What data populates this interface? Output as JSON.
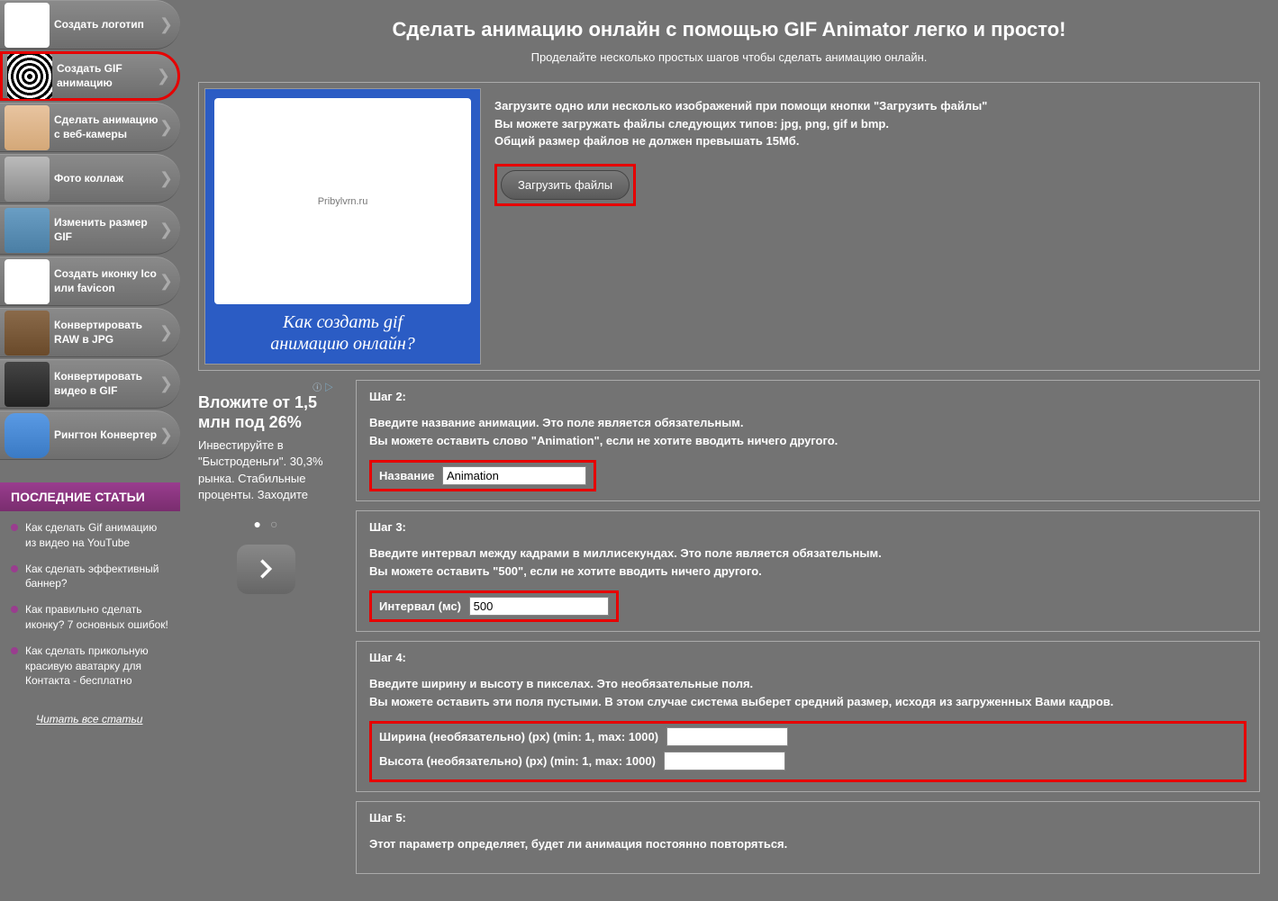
{
  "nav": [
    {
      "label": "Создать логотип",
      "icon": "logo"
    },
    {
      "label": "Создать GIF анимацию",
      "icon": "swirl",
      "active": true
    },
    {
      "label": "Сделать анимацию с веб-камеры",
      "icon": "face"
    },
    {
      "label": "Фото коллаж",
      "icon": "columns"
    },
    {
      "label": "Изменить размер GIF",
      "icon": "resize"
    },
    {
      "label": "Создать иконку Ico или favicon",
      "icon": "ico"
    },
    {
      "label": "Конвертировать RAW в JPG",
      "icon": "raw"
    },
    {
      "label": "Конвертировать видео в GIF",
      "icon": "video"
    },
    {
      "label": "Рингтон Конвертер",
      "icon": "ringtone"
    }
  ],
  "sidebar_section": "ПОСЛЕДНИЕ СТАТЬИ",
  "articles": [
    "Как сделать Gif анимацию из видео на YouTube",
    "Как сделать эффективный баннер?",
    "Как правильно сделать иконку? 7 основных ошибок!",
    "Как сделать прикольную красивую аватарку для Контакта - бесплатно"
  ],
  "read_all": "Читать все статьи",
  "title": "Сделать анимацию онлайн с помощью GIF Animator легко и просто!",
  "subtitle": "Проделайте несколько простых шагов чтобы сделать анимацию онлайн.",
  "ad1": {
    "line1": "Как создать gif",
    "line2": "анимацию онлайн?"
  },
  "upload": {
    "line1": "Загрузите одно или несколько изображений при помощи кнопки \"Загрузить файлы\"",
    "line2": "Вы можете загружать файлы следующих типов: jpg, png, gif и bmp.",
    "line3": "Общий размер файлов не должен превышать 15Мб.",
    "button": "Загрузить файлы"
  },
  "ad2": {
    "choices": "AdChoices",
    "title": "Вложите от 1,5 млн под 26%",
    "body": "Инвестируйте в \"Быстроденьги\". 30,3% рынка. Стабильные проценты. Заходите"
  },
  "step2": {
    "title": "Шаг 2:",
    "desc1": "Введите название анимации. Это поле является обязательным.",
    "desc2": "Вы можете оставить слово \"Animation\", если не хотите вводить ничего другого.",
    "label": "Название",
    "value": "Animation"
  },
  "step3": {
    "title": "Шаг 3:",
    "desc1": "Введите интервал между кадрами в миллисекундах. Это поле является обязательным.",
    "desc2": "Вы можете оставить \"500\", если не хотите вводить ничего другого.",
    "label": "Интервал (мс)",
    "value": "500"
  },
  "step4": {
    "title": "Шаг 4:",
    "desc1": "Введите ширину и высоту в пикселах. Это необязательные поля.",
    "desc2": "Вы можете оставить эти поля пустыми. В этом случае система выберет средний размер, исходя из загруженных Вами кадров.",
    "width_label": "Ширина (необязательно) (px) (min: 1, max: 1000)",
    "height_label": "Высота (необязательно) (px) (min: 1, max: 1000)"
  },
  "step5": {
    "title": "Шаг 5:",
    "desc1": "Этот параметр определяет, будет ли анимация постоянно повторяться."
  }
}
